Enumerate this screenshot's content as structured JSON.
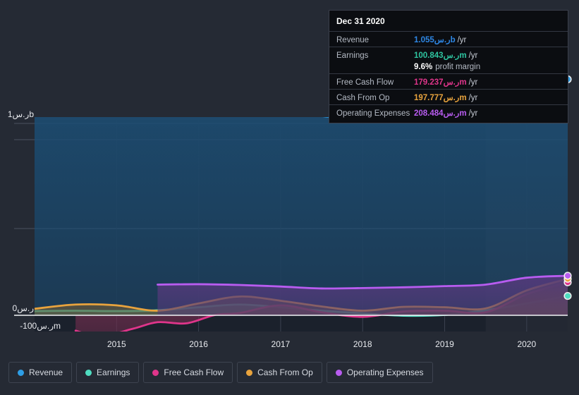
{
  "chart_data": {
    "type": "area",
    "title": "",
    "xlabel": "",
    "ylabel": "",
    "grid": true,
    "legend_position": "bottom",
    "currency_symbol": "ر.س",
    "x_tick_labels": [
      "2015",
      "2016",
      "2017",
      "2018",
      "2019",
      "2020"
    ],
    "y_tick_labels": [
      "1ر.سb",
      "0ر.س",
      "-100ر.سm"
    ],
    "ylim": [
      -150000000,
      1350000000
    ],
    "forecast_region_start": "2020",
    "series": [
      {
        "name": "Revenue",
        "color": "#2e9ee6",
        "fill": "#1d4e74",
        "x": [
          2014.5,
          2015.0,
          2015.5,
          2016.0,
          2016.5,
          2017.0,
          2017.25,
          2017.5,
          2018.0,
          2018.5,
          2019.0,
          2019.5,
          2020.0,
          2020.5,
          2021.0
        ],
        "values": [
          1180000000,
          1240000000,
          1290000000,
          1285000000,
          1270000000,
          1215000000,
          1200000000,
          1150000000,
          1040000000,
          1055000000,
          1060000000,
          1075000000,
          1060000000,
          1150000000,
          1230000000
        ],
        "end_value": 1055000000
      },
      {
        "name": "Earnings",
        "color": "#4fdcc0",
        "fill": "#3e7a72",
        "x": [
          2014.5,
          2015.0,
          2015.5,
          2016.0,
          2016.5,
          2017.0,
          2017.5,
          2018.0,
          2018.5,
          2019.0,
          2019.5,
          2020.0,
          2020.5,
          2021.0
        ],
        "values": [
          22000000,
          24000000,
          22000000,
          26000000,
          42000000,
          56000000,
          42000000,
          24000000,
          10000000,
          -2000000,
          2000000,
          26000000,
          62000000,
          100843000
        ],
        "end_value": 100843000
      },
      {
        "name": "Free Cash Flow",
        "color": "#e0358b",
        "fill": "#6e2d4d",
        "x": [
          2015.0,
          2015.3,
          2015.7,
          2016.0,
          2016.35,
          2016.7,
          2017.0,
          2017.5,
          2018.0,
          2018.5,
          2019.0,
          2019.5,
          2020.0,
          2020.5,
          2021.0
        ],
        "values": [
          -80000000,
          -110000000,
          -70000000,
          -36000000,
          -42000000,
          2000000,
          12000000,
          52000000,
          16000000,
          -8000000,
          20000000,
          24000000,
          16000000,
          110000000,
          172000000
        ],
        "end_value": 179237000
      },
      {
        "name": "Cash From Op",
        "color": "#e8a33d",
        "fill": "#6d5a36",
        "x": [
          2014.5,
          2015.0,
          2015.5,
          2016.0,
          2016.5,
          2017.0,
          2017.5,
          2018.0,
          2018.5,
          2019.0,
          2019.5,
          2020.0,
          2020.5,
          2021.0
        ],
        "values": [
          34000000,
          56000000,
          52000000,
          24000000,
          62000000,
          98000000,
          76000000,
          46000000,
          24000000,
          44000000,
          42000000,
          36000000,
          130000000,
          190000000
        ],
        "end_value": 197777000
      },
      {
        "name": "Operating Expenses",
        "color": "#b85cf0",
        "fill": "#523a7a",
        "x": [
          2016.0,
          2016.5,
          2017.0,
          2017.5,
          2018.0,
          2018.5,
          2019.0,
          2019.5,
          2020.0,
          2020.5,
          2021.0
        ],
        "values": [
          160000000,
          162000000,
          158000000,
          150000000,
          140000000,
          142000000,
          146000000,
          152000000,
          160000000,
          196000000,
          206000000
        ],
        "end_value": 208484000
      }
    ]
  },
  "tooltip": {
    "title": "Dec 31 2020",
    "rows": [
      {
        "label": "Revenue",
        "value": "1.055ر.سb",
        "unit": "/yr",
        "color": "#2e88e6"
      },
      {
        "label": "Earnings",
        "value": "100.843ر.سm",
        "unit": "/yr",
        "color": "#2ec4a0"
      },
      {
        "label": "Free Cash Flow",
        "value": "179.237ر.سm",
        "unit": "/yr",
        "color": "#e0358b"
      },
      {
        "label": "Cash From Op",
        "value": "197.777ر.سm",
        "unit": "/yr",
        "color": "#e8a33d"
      },
      {
        "label": "Operating Expenses",
        "value": "208.484ر.سm",
        "unit": "/yr",
        "color": "#b85cf0"
      }
    ],
    "profit_margin_value": "9.6%",
    "profit_margin_label": "profit margin"
  },
  "legend": {
    "items": [
      {
        "label": "Revenue",
        "color": "#2e9ee6"
      },
      {
        "label": "Earnings",
        "color": "#4fdcc0"
      },
      {
        "label": "Free Cash Flow",
        "color": "#e0358b"
      },
      {
        "label": "Cash From Op",
        "color": "#e8a33d"
      },
      {
        "label": "Operating Expenses",
        "color": "#b85cf0"
      }
    ]
  },
  "axis": {
    "y_top_label": "1ر.سb",
    "y_zero_label": "0ر.س",
    "y_neg_label": "-100ر.سm",
    "x_labels": [
      "2015",
      "2016",
      "2017",
      "2018",
      "2019",
      "2020"
    ]
  }
}
